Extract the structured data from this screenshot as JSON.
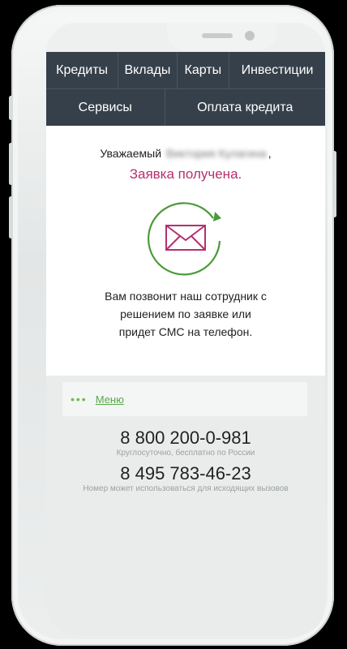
{
  "nav": {
    "row1": [
      "Кредиты",
      "Вклады",
      "Карты",
      "Инвестиции"
    ],
    "row2": [
      "Сервисы",
      "Оплата кредита"
    ]
  },
  "confirmation": {
    "greeting_prefix": "Уважаемый",
    "customer_name_redacted": "Виктория Кулагина",
    "greeting_suffix": ",",
    "status": "Заявка получена.",
    "icon": "envelope-refresh-icon",
    "message_lines": [
      "Вам позвонит наш сотрудник с",
      "решением по заявке или",
      "придет СМС на телефон."
    ]
  },
  "footer": {
    "menu_dots": "•••",
    "menu_label": "Меню",
    "phones": [
      {
        "number": "8 800 200-0-981",
        "caption": "Круглосуточно, бесплатно по России"
      },
      {
        "number": "8 495 783-46-23",
        "caption": "Номер может использоваться для исходящих вызовов"
      }
    ]
  },
  "colors": {
    "nav_bg": "#36404a",
    "accent_pink": "#b5306e",
    "accent_green": "#4a9a3a"
  }
}
